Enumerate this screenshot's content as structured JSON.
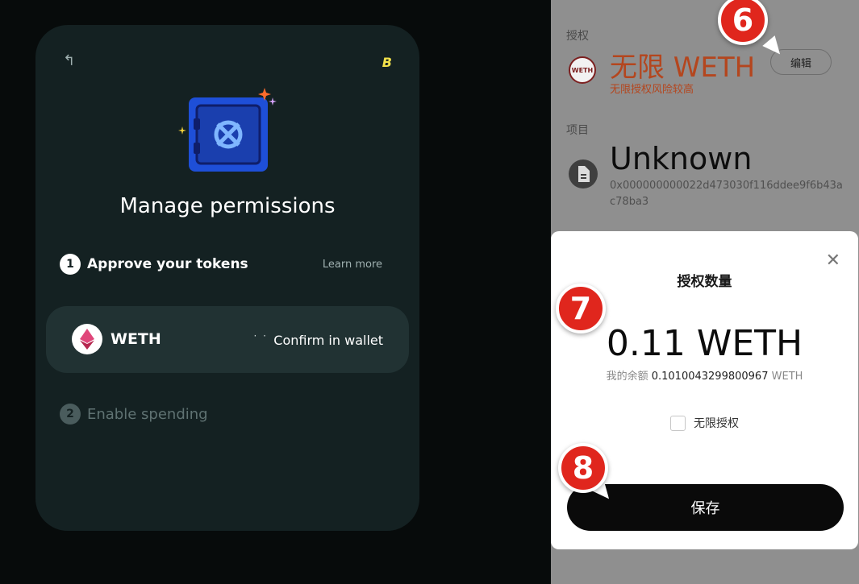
{
  "left_card": {
    "back_icon": "back-arrow-icon",
    "brand_logo": "B",
    "title": "Manage permissions",
    "step1": {
      "number": "1",
      "label": "Approve your tokens",
      "link": "Learn more"
    },
    "token": {
      "name": "WETH",
      "status": "Confirm in wallet",
      "spinner": "· ·"
    },
    "step2": {
      "number": "2",
      "label": "Enable spending"
    }
  },
  "right_panel": {
    "auth_label": "授权",
    "auth_value": "无限 WETH",
    "auth_warning": "无限授权风险较高",
    "edit_button": "编辑",
    "weth_icon_text": "WETH",
    "project_label": "项目",
    "project_name": "Unknown",
    "project_address": "0x000000000022d473030f116ddee9f6b43ac78ba3"
  },
  "modal": {
    "title": "授权数量",
    "amount": "0.11 WETH",
    "balance_label": "我的余额",
    "balance_value": "0.1010043299800967",
    "balance_unit": "WETH",
    "unlimited_checkbox_label": "无限授权",
    "save_button": "保存"
  },
  "callouts": {
    "six": "6",
    "seven": "7",
    "eight": "8"
  },
  "colors": {
    "accent_red": "#e0261d",
    "warning_orange": "#b4461e",
    "card_bg": "#142122"
  }
}
